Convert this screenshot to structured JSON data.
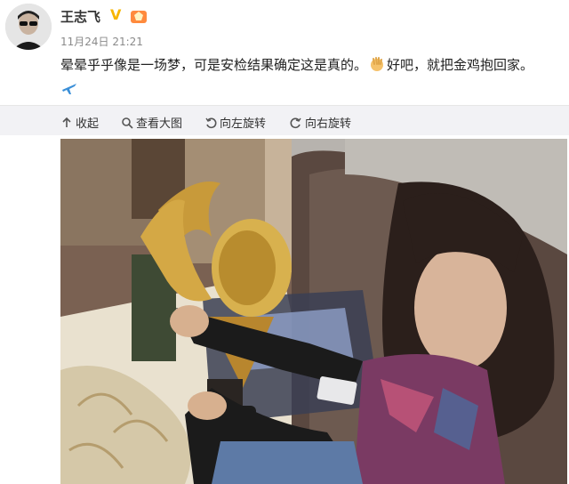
{
  "post": {
    "username": "王志飞",
    "timestamp": "11月24日 21:21",
    "text_part1": "晕晕乎乎像是一场梦，可是安检结果确定这是真的。",
    "text_part2": "好吧，就把金鸡抱回家。",
    "verified_icon": "V",
    "icons": [
      "avatar",
      "verified-v-icon",
      "medal-icon",
      "ok-hand-emoji",
      "airplane-emoji"
    ]
  },
  "toolbar": {
    "collapse": "收起",
    "view_large": "查看大图",
    "rotate_left": "向左旋转",
    "rotate_right": "向右旋转"
  },
  "colors": {
    "verified": "#f7b500",
    "toolbar_bg": "#f2f2f5",
    "text": "#222222",
    "muted": "#8a8a8a"
  }
}
